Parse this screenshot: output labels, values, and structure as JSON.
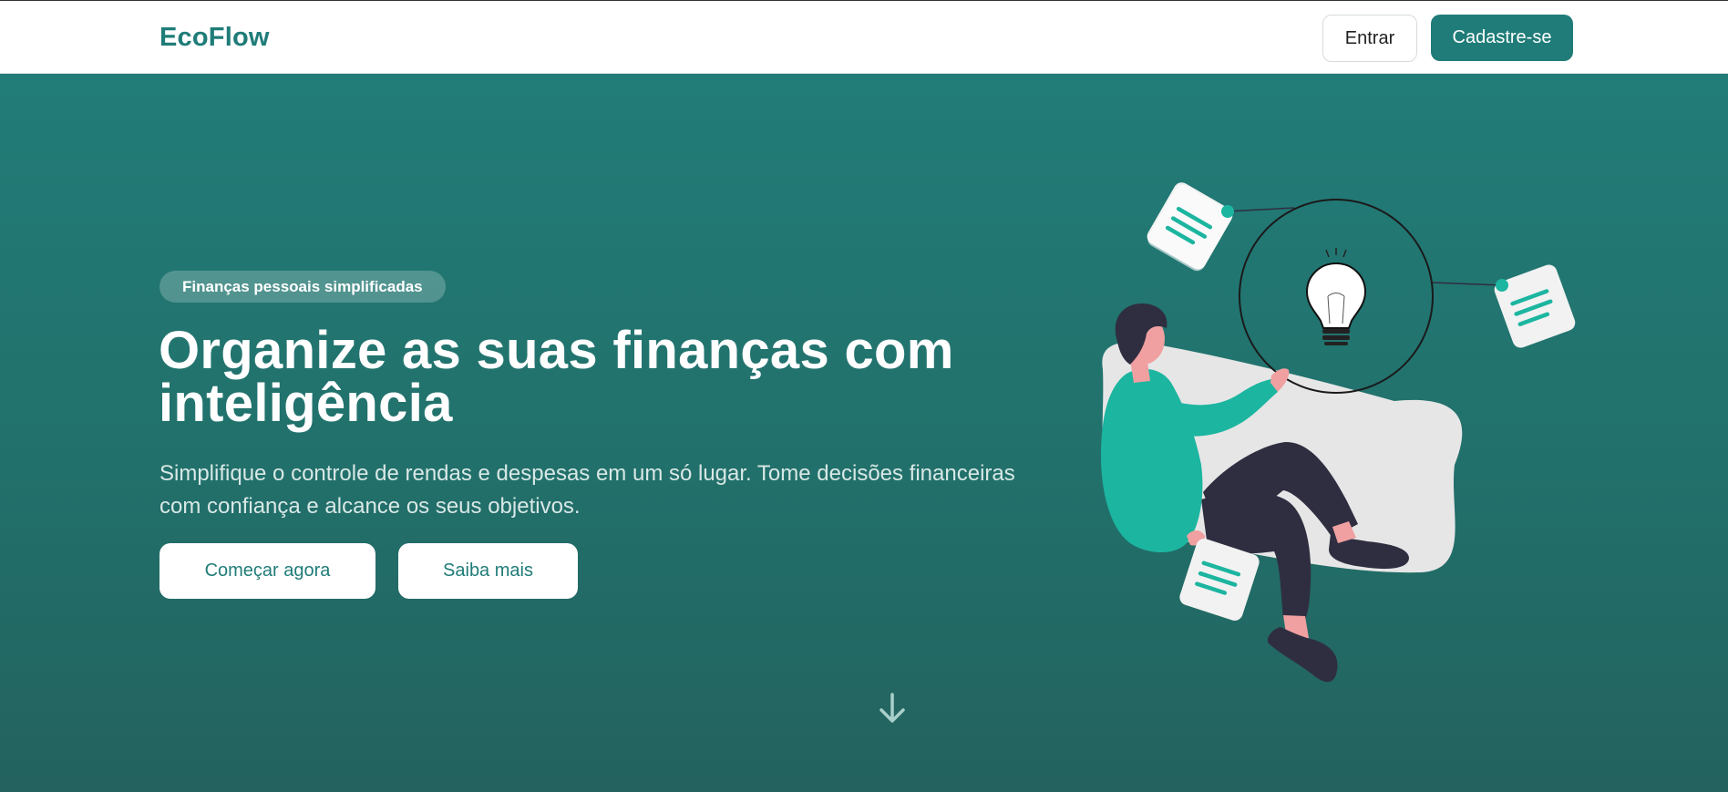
{
  "navbar": {
    "brand": "EcoFlow",
    "login_label": "Entrar",
    "signup_label": "Cadastre-se"
  },
  "hero": {
    "badge": "Finanças pessoais simplificadas",
    "headline": "Organize as suas finanças com inteligência",
    "subtitle": "Simplifique o controle de rendas e despesas em um só lugar. Tome decisões financeiras com confiança e alcance os seus objetivos.",
    "primary_cta": "Começar agora",
    "secondary_cta": "Saiba mais",
    "scroll_icon": "arrow-down-icon"
  },
  "colors": {
    "brand": "#1f7c78",
    "accent": "#1cb5a0",
    "hero_bg": "#227c78",
    "skin": "#f0a0a0",
    "dark": "#2f2e41"
  }
}
